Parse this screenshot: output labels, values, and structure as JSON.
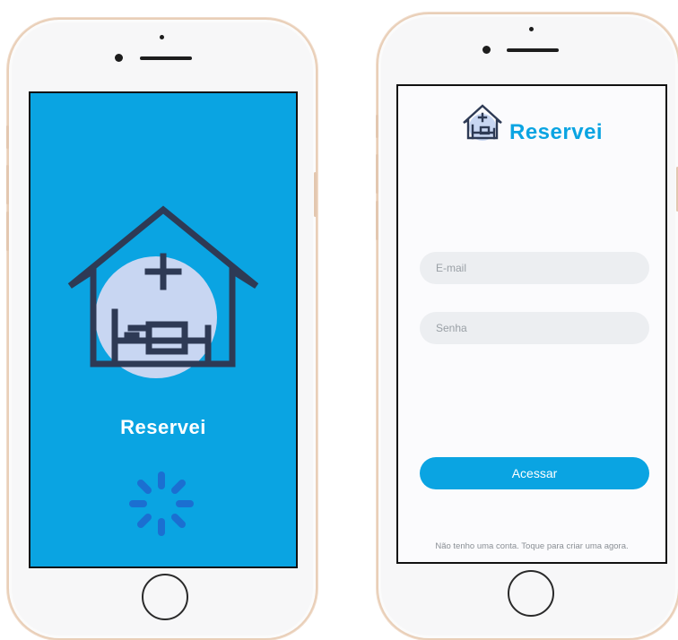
{
  "splash": {
    "app_name": "Reservei",
    "loading_indicator": "spinner-icon"
  },
  "login": {
    "app_name": "Reservei",
    "email_placeholder": "E-mail",
    "password_placeholder": "Senha",
    "submit_label": "Acessar",
    "signup_prompt": "Não tenho uma conta. Toque para criar uma agora."
  },
  "colors": {
    "brand": "#0aa4e2",
    "logo_stroke": "#2e3a55",
    "logo_circle": "#c8d6f2"
  }
}
